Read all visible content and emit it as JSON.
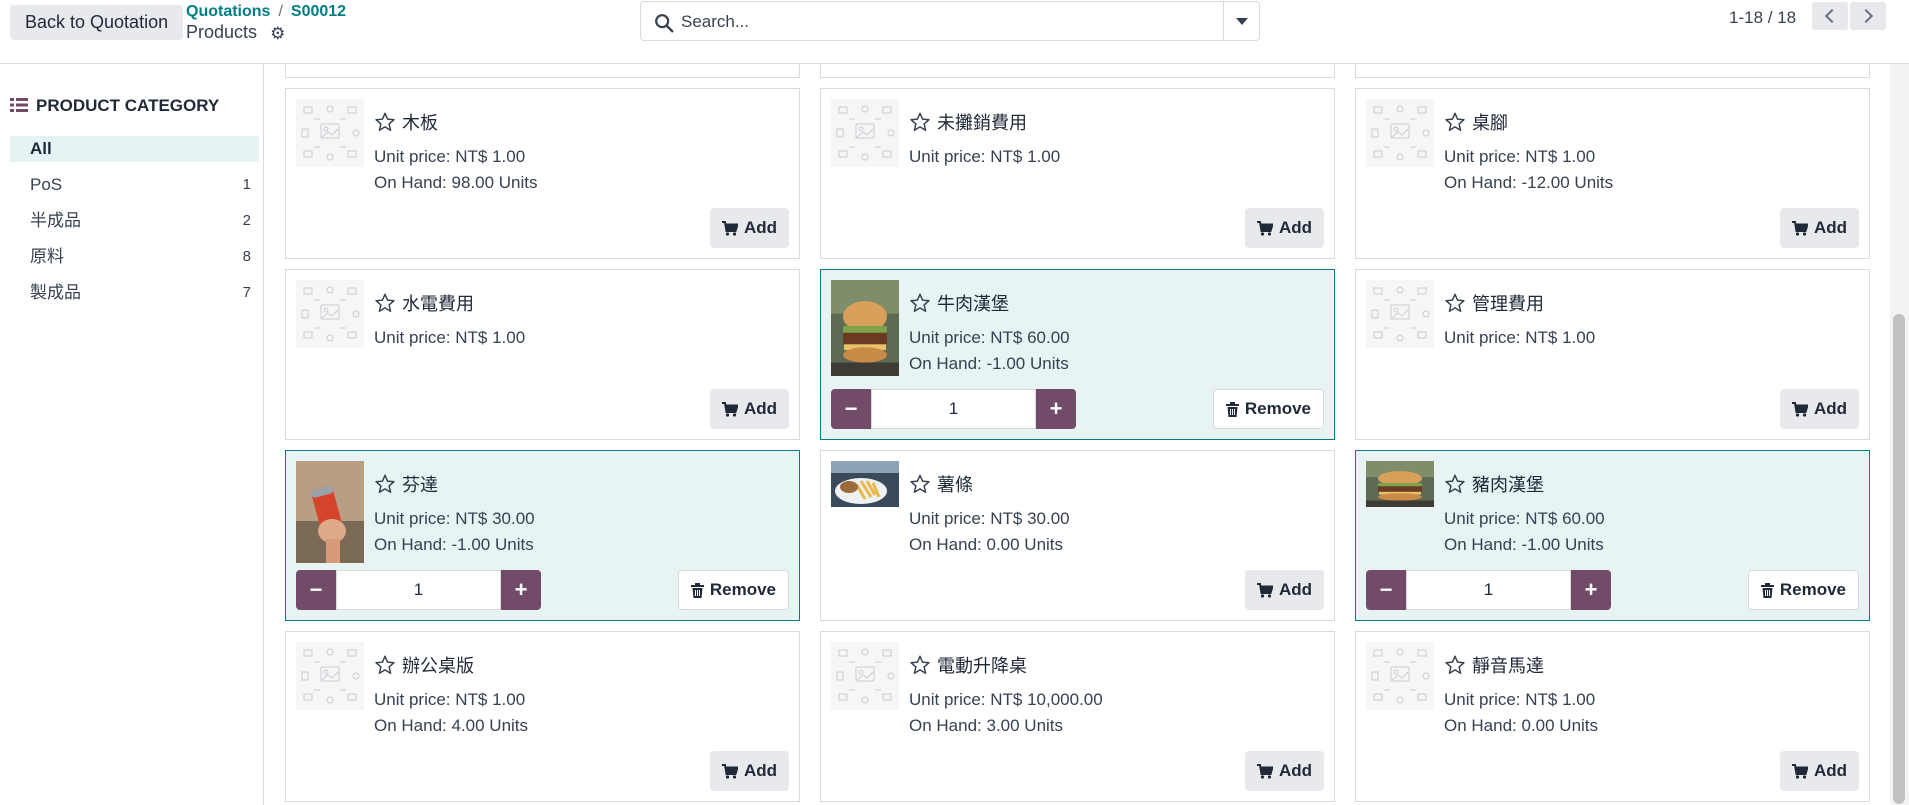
{
  "header": {
    "back_label": "Back to Quotation",
    "breadcrumb": [
      "Quotations",
      "S00012"
    ],
    "title": "Products",
    "search_placeholder": "Search...",
    "pager": "1-18 / 18"
  },
  "sidebar": {
    "heading": "PRODUCT CATEGORY",
    "categories": [
      {
        "label": "All",
        "count": "",
        "active": true
      },
      {
        "label": "PoS",
        "count": "1"
      },
      {
        "label": "半成品",
        "count": "2"
      },
      {
        "label": "原料",
        "count": "8"
      },
      {
        "label": "製成品",
        "count": "7"
      }
    ]
  },
  "buttons": {
    "add": "Add",
    "remove": "Remove"
  },
  "products": [
    {
      "name": "木板",
      "price": "Unit price: NT$ 1.00",
      "onhand": "On Hand: 98.00 Units",
      "selected": false,
      "image": "placeholder"
    },
    {
      "name": "未攤銷費用",
      "price": "Unit price: NT$ 1.00",
      "onhand": "",
      "selected": false,
      "image": "placeholder"
    },
    {
      "name": "桌腳",
      "price": "Unit price: NT$ 1.00",
      "onhand": "On Hand: -12.00 Units",
      "selected": false,
      "image": "placeholder"
    },
    {
      "name": "水電費用",
      "price": "Unit price: NT$ 1.00",
      "onhand": "",
      "selected": false,
      "image": "placeholder"
    },
    {
      "name": "牛肉漢堡",
      "price": "Unit price: NT$ 60.00",
      "onhand": "On Hand: -1.00 Units",
      "selected": true,
      "qty": "1",
      "image": "burger"
    },
    {
      "name": "管理費用",
      "price": "Unit price: NT$ 1.00",
      "onhand": "",
      "selected": false,
      "image": "placeholder"
    },
    {
      "name": "芬達",
      "price": "Unit price: NT$ 30.00",
      "onhand": "On Hand: -1.00 Units",
      "selected": true,
      "qty": "1",
      "image": "soda"
    },
    {
      "name": "薯條",
      "price": "Unit price: NT$ 30.00",
      "onhand": "On Hand: 0.00 Units",
      "selected": false,
      "image": "fries"
    },
    {
      "name": "豬肉漢堡",
      "price": "Unit price: NT$ 60.00",
      "onhand": "On Hand: -1.00 Units",
      "selected": true,
      "qty": "1",
      "image": "burger-wide"
    },
    {
      "name": "辦公桌版",
      "price": "Unit price: NT$ 1.00",
      "onhand": "On Hand: 4.00 Units",
      "selected": false,
      "image": "placeholder"
    },
    {
      "name": "電動升降桌",
      "price": "Unit price: NT$ 10,000.00",
      "onhand": "On Hand: 3.00 Units",
      "selected": false,
      "image": "placeholder"
    },
    {
      "name": "靜音馬達",
      "price": "Unit price: NT$ 1.00",
      "onhand": "On Hand: 0.00 Units",
      "selected": false,
      "image": "placeholder"
    }
  ]
}
